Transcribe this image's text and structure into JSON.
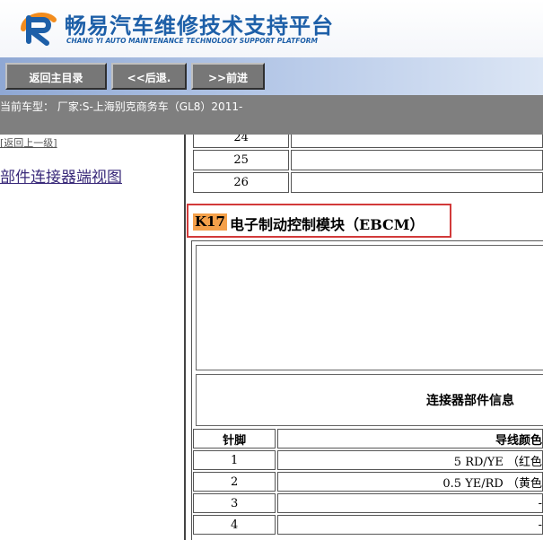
{
  "brand": {
    "title": "畅易汽车维修技术支持平台",
    "subtitle": "CHANG YI AUTO MAINTENANCE TECHNOLOGY SUPPORT PLATFORM",
    "colors": {
      "primary": "#1d5fa8",
      "accent": "#f28c1e"
    }
  },
  "nav": {
    "home_label": "返回主目录",
    "back_label": "<<后退.",
    "forward_label": ">>前进"
  },
  "vehicle": {
    "text": "当前车型： 厂家:S-上海别克商务车（GL8）2011-"
  },
  "sidebar": {
    "back_up_label": "[返回上一级]",
    "connector_view_label": "部件连接器端视图"
  },
  "top_table": {
    "rows": [
      "24",
      "25",
      "26"
    ]
  },
  "component": {
    "code": "K17",
    "name": "电子制动控制模块（EBCM）"
  },
  "connector": {
    "info_label": "连接器部件信息",
    "headers": [
      "针脚",
      "导线颜色"
    ],
    "rows": [
      [
        "1",
        "5 RD/YE （红色"
      ],
      [
        "2",
        "0.5 YE/RD （黄色"
      ],
      [
        "3",
        "-"
      ],
      [
        "4",
        "-"
      ]
    ]
  }
}
